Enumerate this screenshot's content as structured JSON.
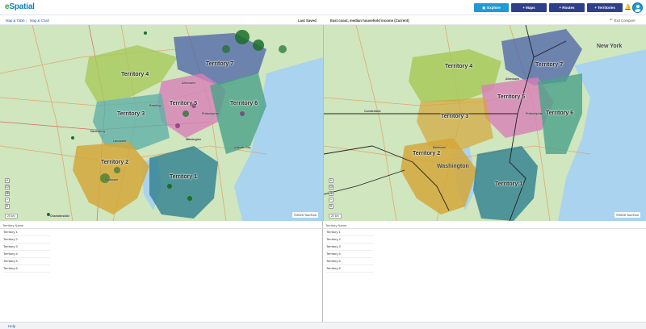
{
  "brand": {
    "logo_prefix": "e",
    "logo_text": "Spatial"
  },
  "nav": {
    "explore": "Explore",
    "maps": "+ Maps",
    "routes": "+ Routes",
    "territories": "+ Territories"
  },
  "subbar": {
    "tab_map_table": "Map & Table",
    "tab_map_chart": "Map & Chart",
    "separator": "|",
    "left_title": "Last Saved",
    "right_title": "East coast, median household income (Current)",
    "exit_compare": "Exit Compare"
  },
  "map_left": {
    "territories": [
      "Territory 1",
      "Territory 2",
      "Territory 3",
      "Territory 4",
      "Territory 5",
      "Territory 6",
      "Territory 7"
    ],
    "cities": [
      "Allentown",
      "Reading",
      "Philadelphia",
      "Baltimore",
      "Trenton",
      "Atlantic City",
      "Dover",
      "Harrisburg",
      "Lancaster",
      "Wilmington",
      "Charlottesville",
      "Frederick",
      "Hagerstown",
      "Chambersburg"
    ],
    "scale": "20 km",
    "attribution": "©2025 TomTom"
  },
  "map_right": {
    "territories": [
      "Territory 1",
      "Territory 2",
      "Territory 3",
      "Territory 4",
      "Territory 5",
      "Territory 6",
      "Territory 7"
    ],
    "cities": [
      "New York",
      "Washington",
      "Baltimore",
      "Philadelphia",
      "Allentown",
      "Cumberland",
      "Columbia",
      "Dover"
    ],
    "scale": "20 km",
    "attribution": "©2025 TomTom"
  },
  "zoom_controls": [
    "+",
    "⊙",
    "⊕",
    "−",
    "≡"
  ],
  "table_left": {
    "header": "Territory Name",
    "rows": [
      "Territory 1",
      "Territory 2",
      "Territory 3",
      "Territory 4",
      "Territory 5",
      "Territory 6"
    ]
  },
  "table_right": {
    "header": "Territory Name",
    "rows": [
      "Territory 1",
      "Territory 2",
      "Territory 3",
      "Territory 4",
      "Territory 5",
      "Territory 6"
    ]
  },
  "footer": {
    "help": "Help"
  },
  "colors": {
    "explore": "#1e9ad6",
    "nav": "#2f3f8a",
    "water": "#a9d3ee",
    "land": "#cfe6bf",
    "t1_teal": "#2e7f8f",
    "t2_gold": "#d4a73a",
    "t3_aqua": "#5fb0a8",
    "t4_lime": "#a8c95a",
    "t5_pink": "#d77fb8",
    "t6_teal": "#4aa28a",
    "t7_blue": "#4b61a8"
  }
}
